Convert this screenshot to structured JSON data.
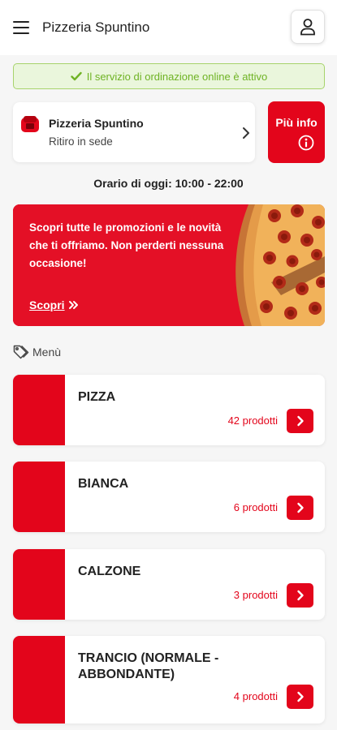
{
  "header": {
    "title": "Pizzeria Spuntino",
    "menu_icon": "hamburger-icon",
    "user_icon": "user-icon"
  },
  "status": {
    "text": "Il servizio di ordinazione online è attivo",
    "icon": "check-icon"
  },
  "store": {
    "name": "Pizzeria Spuntino",
    "mode": "Ritiro in sede",
    "logo_icon": "pizzeria-logo-icon",
    "chevron_icon": "chevron-right-icon"
  },
  "info_button": {
    "label": "Più info",
    "icon": "info-icon"
  },
  "hours": "Orario di oggi: 10:00 - 22:00",
  "promo": {
    "text": "Scopri tutte le promozioni e le novità che ti offriamo. Non perderti nessuna occasione!",
    "link": "Scopri",
    "link_icon": "double-chevron-right-icon",
    "image": "pizza-photo"
  },
  "menu_section": {
    "label": "Menù",
    "icon": "tag-icon"
  },
  "categories": [
    {
      "name": "PIZZA",
      "count": "42 prodotti"
    },
    {
      "name": "BIANCA",
      "count": "6 prodotti"
    },
    {
      "name": "CALZONE",
      "count": "3 prodotti"
    },
    {
      "name": "TRANCIO (NORMALE - ABBONDANTE)",
      "count": "4 prodotti"
    }
  ],
  "colors": {
    "accent": "#e3051b",
    "success": "#6fb324",
    "success_bg": "#eaf6dc"
  }
}
